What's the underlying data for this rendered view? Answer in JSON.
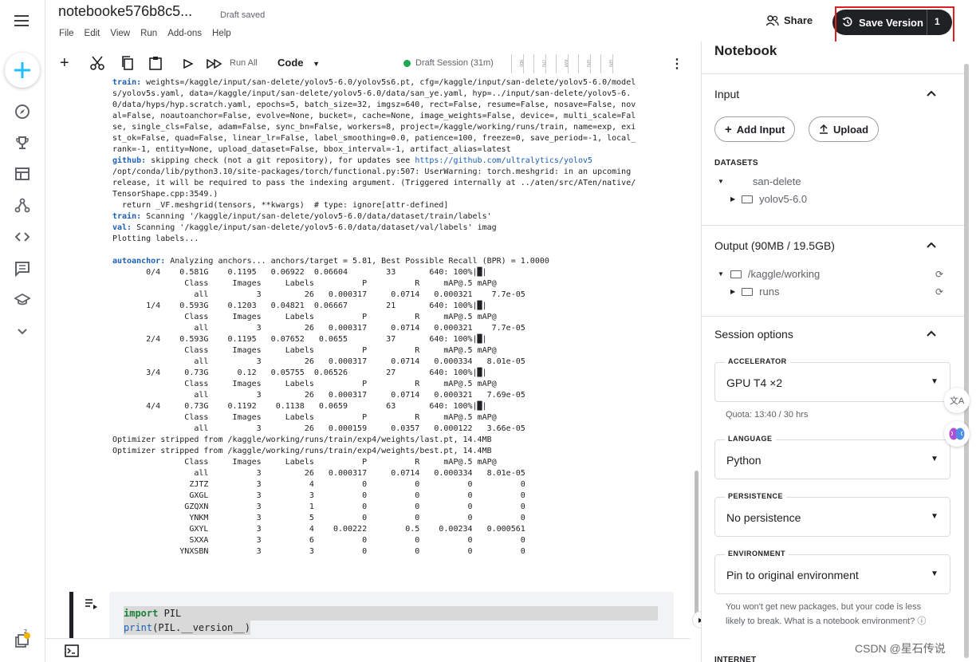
{
  "header": {
    "notebook_title": "notebooke576b8c5...",
    "status": "Draft saved",
    "menu": [
      "File",
      "Edit",
      "View",
      "Run",
      "Add-ons",
      "Help"
    ],
    "share_label": "Share",
    "save_label": "Save Version",
    "save_count": "1"
  },
  "toolbar": {
    "run_all": "Run All",
    "cell_type": "Code",
    "session": "Draft Session (31m)",
    "meters": [
      "HDD",
      "CPU",
      "RAM",
      "GPU",
      "GPU"
    ]
  },
  "output": {
    "lines": [
      [
        {
          "t": "train:",
          "c": "k"
        },
        {
          "t": " weights=/kaggle/input/san-delete/yolov5-6.0/yolov5s6.pt, cfg=/kaggle/input/san-delete/yolov5-6.0/model"
        }
      ],
      [
        {
          "t": "s/yolov5s.yaml, data=/kaggle/input/san-delete/yolov5-6.0/data/san_ye.yaml, hyp=../input/san-delete/yolov5-6."
        }
      ],
      [
        {
          "t": "0/data/hyps/hyp.scratch.yaml, epochs=5, batch_size=32, imgsz=640, rect=False, resume=False, nosave=False, nov"
        }
      ],
      [
        {
          "t": "al=False, noautoanchor=False, evolve=None, bucket=, cache=None, image_weights=False, device=, multi_scale=Fal"
        }
      ],
      [
        {
          "t": "se, single_cls=False, adam=False, sync_bn=False, workers=8, project=/kaggle/working/runs/train, name=exp, exi"
        }
      ],
      [
        {
          "t": "st_ok=False, quad=False, linear_lr=False, label_smoothing=0.0, patience=100, freeze=0, save_period=-1, local_"
        }
      ],
      [
        {
          "t": "rank=-1, entity=None, upload_dataset=False, bbox_interval=-1, artifact_alias=latest"
        }
      ],
      [
        {
          "t": "github:",
          "c": "k"
        },
        {
          "t": " skipping check (not a git repository), for updates see "
        },
        {
          "t": "https://github.com/ultralytics/yolov5",
          "c": "lnk"
        }
      ],
      [
        {
          "t": "/opt/conda/lib/python3.10/site-packages/torch/functional.py:507: UserWarning: torch.meshgrid: in an upcoming"
        }
      ],
      [
        {
          "t": "release, it will be required to pass the indexing argument. (Triggered internally at ../aten/src/ATen/native/"
        }
      ],
      [
        {
          "t": "TensorShape.cpp:3549.)"
        }
      ],
      [
        {
          "t": "  return _VF.meshgrid(tensors, **kwargs)  # type: ignore[attr-defined]"
        }
      ],
      [
        {
          "t": "train:",
          "c": "k"
        },
        {
          "t": " Scanning '/kaggle/input/san-delete/yolov5-6.0/data/dataset/train/labels'"
        }
      ],
      [
        {
          "t": "val:",
          "c": "k"
        },
        {
          "t": " Scanning '/kaggle/input/san-delete/yolov5-6.0/data/dataset/val/labels' imag"
        }
      ],
      [
        {
          "t": "Plotting labels..."
        }
      ],
      [
        {
          "t": ""
        }
      ],
      [
        {
          "t": "autoanchor:",
          "c": "k"
        },
        {
          "t": " Analyzing anchors... anchors/target = 5.81, Best Possible Recall (BPR) = 1.0000"
        }
      ],
      [
        {
          "t": "       0/4    0.581G    0.1195   0.06922  0.06604        33       640: 100%|█|"
        }
      ],
      [
        {
          "t": "               Class     Images     Labels          P          R     mAP@.5 mAP@"
        }
      ],
      [
        {
          "t": "                 all          3         26   0.000317     0.0714   0.000321    7.7e-05"
        }
      ],
      [
        {
          "t": "       1/4    0.593G    0.1203   0.04821  0.06667        21       640: 100%|█|"
        }
      ],
      [
        {
          "t": "               Class     Images     Labels          P          R     mAP@.5 mAP@"
        }
      ],
      [
        {
          "t": "                 all          3         26   0.000317     0.0714   0.000321    7.7e-05"
        }
      ],
      [
        {
          "t": "       2/4    0.593G    0.1195   0.07652   0.0655        37       640: 100%|█|"
        }
      ],
      [
        {
          "t": "               Class     Images     Labels          P          R     mAP@.5 mAP@"
        }
      ],
      [
        {
          "t": "                 all          3         26   0.000317     0.0714   0.000334   8.01e-05"
        }
      ],
      [
        {
          "t": "       3/4     0.73G      0.12   0.05755  0.06526        27       640: 100%|█|"
        }
      ],
      [
        {
          "t": "               Class     Images     Labels          P          R     mAP@.5 mAP@"
        }
      ],
      [
        {
          "t": "                 all          3         26   0.000317     0.0714   0.000321   7.69e-05"
        }
      ],
      [
        {
          "t": "       4/4     0.73G    0.1192    0.1138   0.0659        63       640: 100%|█|"
        }
      ],
      [
        {
          "t": "               Class     Images     Labels          P          R     mAP@.5 mAP@"
        }
      ],
      [
        {
          "t": "                 all          3         26   0.000159     0.0357   0.000122   3.66e-05"
        }
      ],
      [
        {
          "t": "Optimizer stripped from /kaggle/working/runs/train/exp4/weights/last.pt, 14.4MB"
        }
      ],
      [
        {
          "t": "Optimizer stripped from /kaggle/working/runs/train/exp4/weights/best.pt, 14.4MB"
        }
      ],
      [
        {
          "t": "               Class     Images     Labels          P          R     mAP@.5 mAP@"
        }
      ],
      [
        {
          "t": "                 all          3         26   0.000317     0.0714   0.000334   8.01e-05"
        }
      ],
      [
        {
          "t": "                ZJTZ          3          4          0          0          0          0"
        }
      ],
      [
        {
          "t": "                GXGL          3          3          0          0          0          0"
        }
      ],
      [
        {
          "t": "               GZQXN          3          1          0          0          0          0"
        }
      ],
      [
        {
          "t": "                YNKM          3          5          0          0          0          0"
        }
      ],
      [
        {
          "t": "                GXYL          3          4    0.00222        0.5    0.00234   0.000561"
        }
      ],
      [
        {
          "t": "                SXXA          3          6          0          0          0          0"
        }
      ],
      [
        {
          "t": "              YNXSBN          3          3          0          0          0          0"
        }
      ]
    ]
  },
  "cell": {
    "line1_kw": "import",
    "line1_rest": " PIL",
    "line2_fn": "print",
    "line2_rest": "(PIL.__version__)"
  },
  "panel": {
    "title": "Notebook",
    "input": {
      "title": "Input",
      "add_input": "Add Input",
      "upload": "Upload",
      "datasets_label": "DATASETS",
      "dataset_name": "san-delete",
      "dataset_child": "yolov5-6.0"
    },
    "output": {
      "title": "Output (90MB / 19.5GB)",
      "root": "/kaggle/working",
      "child": "runs"
    },
    "session": {
      "title": "Session options",
      "accelerator_label": "ACCELERATOR",
      "accelerator_value": "GPU T4 ×2",
      "quota": "Quota: 13:40 / 30 hrs",
      "language_label": "LANGUAGE",
      "language_value": "Python",
      "persistence_label": "PERSISTENCE",
      "persistence_value": "No persistence",
      "environment_label": "ENVIRONMENT",
      "environment_value": "Pin to original environment",
      "environment_note": "You won't get new packages, but your code is less likely to break. What is a notebook environment?",
      "internet_label": "INTERNET"
    }
  },
  "rail": {
    "badge": "2"
  },
  "watermark": "CSDN @星石传说"
}
